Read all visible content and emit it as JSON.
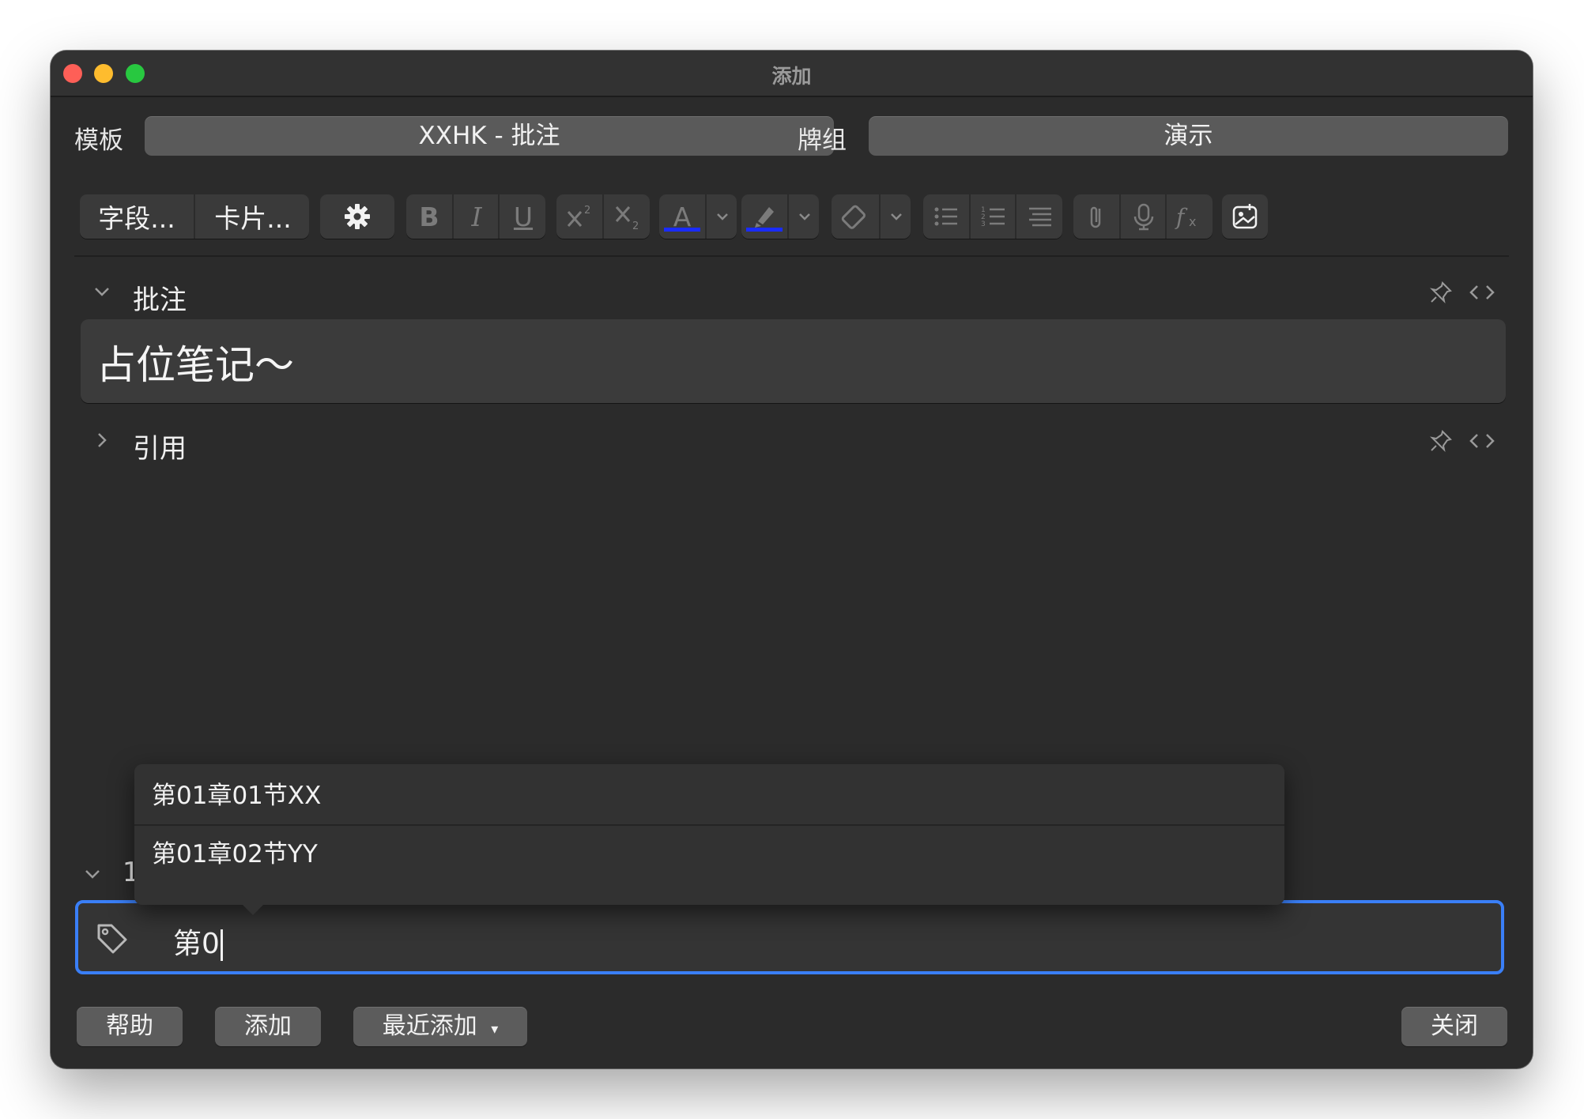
{
  "window": {
    "title": "添加"
  },
  "header": {
    "model_label": "模板",
    "model_value": "XXHK - 批注",
    "deck_label": "牌组",
    "deck_value": "演示"
  },
  "toolbar": {
    "fields_label": "字段...",
    "cards_label": "卡片...",
    "bold": "B",
    "italic": "I",
    "underline": "U",
    "text_color": "A",
    "icons": [
      "gear-icon",
      "superscript-icon",
      "subscript-icon",
      "text-color-icon",
      "highlight-icon",
      "eraser-icon",
      "bullet-list-icon",
      "numbered-list-icon",
      "align-icon",
      "attachment-icon",
      "microphone-icon",
      "formula-icon",
      "image-occlusion-icon"
    ],
    "text_color_hex": "#1a2cff",
    "highlight_color_hex": "#1a2cff"
  },
  "fields": [
    {
      "name": "批注",
      "expanded": true,
      "value": "占位笔记～"
    },
    {
      "name": "引用",
      "expanded": false
    }
  ],
  "tags": {
    "count_label": "1",
    "input_value": "第0",
    "suggestions": [
      "第01章01节XX",
      "第01章02节YY"
    ],
    "focus_color": "#3a7ff7"
  },
  "footer": {
    "help": "帮助",
    "add": "添加",
    "history": "最近添加",
    "history_arrow": "▾",
    "close": "关闭"
  }
}
